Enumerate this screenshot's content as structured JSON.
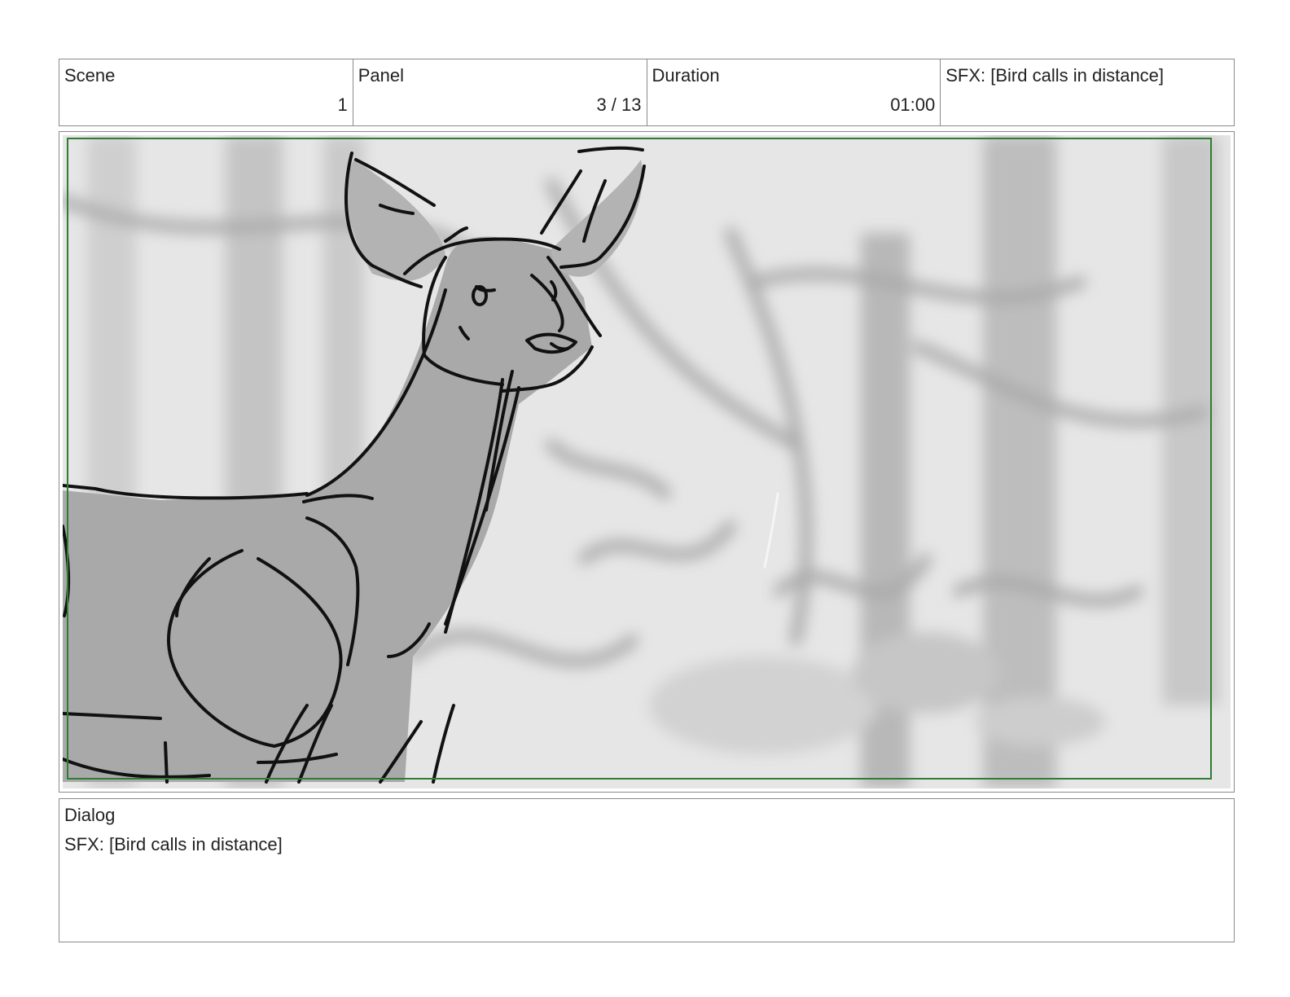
{
  "header": {
    "scene": {
      "label": "Scene",
      "value": "1"
    },
    "panel": {
      "label": "Panel",
      "value": "3 / 13"
    },
    "duration": {
      "label": "Duration",
      "value": "01:00"
    },
    "note": "SFX: [Bird calls in distance]"
  },
  "frame": {
    "safe_area_color": "#2e7d32"
  },
  "dialog": {
    "label": "Dialog",
    "text": "SFX: [Bird calls in distance]"
  }
}
